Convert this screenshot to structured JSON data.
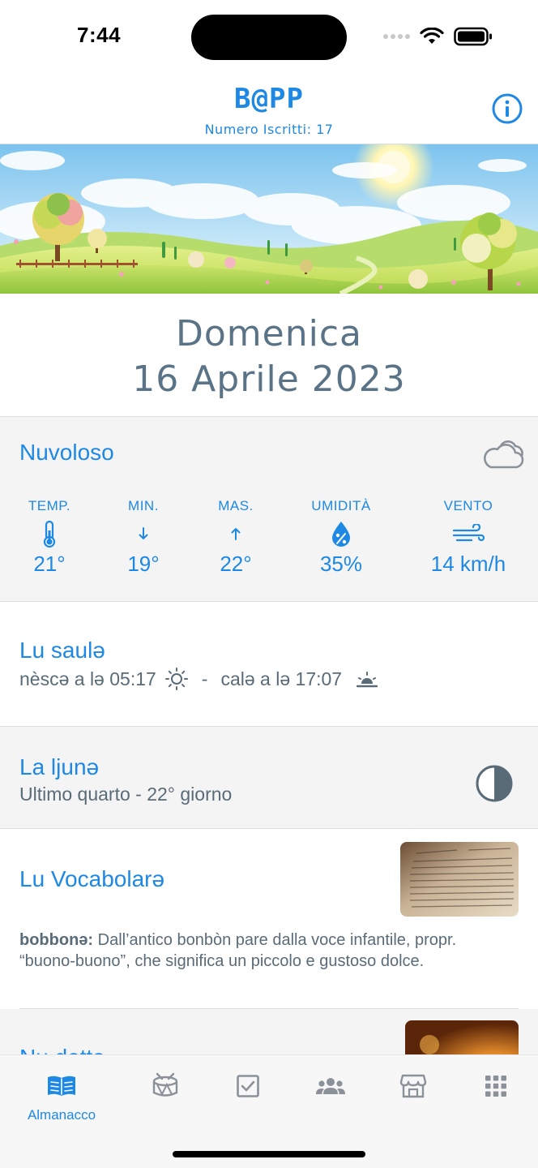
{
  "status_bar": {
    "time": "7:44"
  },
  "header": {
    "title": "B@PP",
    "subtitle": "Numero Iscritti: 17"
  },
  "date": {
    "day": "Domenica",
    "full": "16 Aprile 2023"
  },
  "weather": {
    "condition": "Nuvoloso",
    "columns": [
      {
        "label": "TEMP.",
        "value": "21°",
        "icon": "thermometer-icon"
      },
      {
        "label": "MIN.",
        "value": "19°",
        "icon": "arrow-down-icon"
      },
      {
        "label": "MAS.",
        "value": "22°",
        "icon": "arrow-up-icon"
      },
      {
        "label": "UMIDITÀ",
        "value": "35%",
        "icon": "humidity-drop-icon"
      },
      {
        "label": "VENTO",
        "value": "14 km/h",
        "icon": "wind-icon"
      }
    ]
  },
  "sun": {
    "title": "Lu saulə",
    "sunrise": "nèscə a lə 05:17",
    "separator": "-",
    "sunset": "calə a lə 17:07"
  },
  "moon": {
    "title": "La ljunə",
    "phase": "Ultimo quarto - 22° giorno"
  },
  "vocab": {
    "title": "Lu Vocabolarə",
    "word": "bobbonə:",
    "definition": " Dall’antico bonbòn pare dalla voce infantile, propr. “buono-buono”, che significa un piccolo e gustoso dolce."
  },
  "detto": {
    "title": "Nu dettə"
  },
  "tabs": [
    {
      "label": "Almanacco",
      "icon": "book-icon",
      "active": true
    },
    {
      "label": "",
      "icon": "drum-icon",
      "active": false
    },
    {
      "label": "",
      "icon": "checkbox-icon",
      "active": false
    },
    {
      "label": "",
      "icon": "people-icon",
      "active": false
    },
    {
      "label": "",
      "icon": "store-icon",
      "active": false
    },
    {
      "label": "",
      "icon": "grid-icon",
      "active": false
    }
  ],
  "colors": {
    "accent": "#1e88e5",
    "text_gray": "#5a7386",
    "inactive_icon": "#8a9199"
  }
}
